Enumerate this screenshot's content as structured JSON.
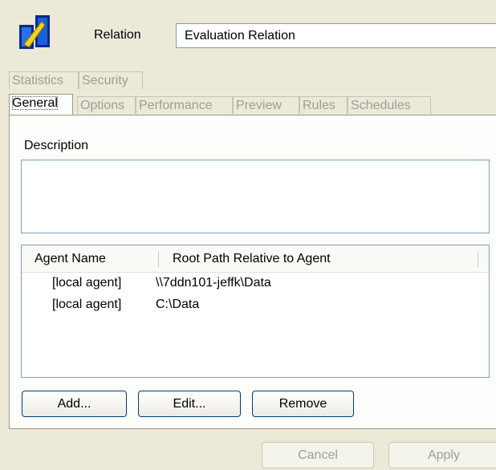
{
  "header": {
    "icon": "relation-icon",
    "relation_label": "Relation",
    "relation_name": "Evaluation Relation"
  },
  "tabs": {
    "row1": [
      {
        "label": "Statistics",
        "active": false
      },
      {
        "label": "Security",
        "active": false
      }
    ],
    "row2": [
      {
        "label": "General",
        "active": true
      },
      {
        "label": "Options",
        "active": false
      },
      {
        "label": "Performance",
        "active": false
      },
      {
        "label": "Preview",
        "active": false
      },
      {
        "label": "Rules",
        "active": false
      },
      {
        "label": "Schedules",
        "active": false
      }
    ]
  },
  "general": {
    "description_label": "Description",
    "description_value": "",
    "agents_table": {
      "columns": [
        "Agent Name",
        "Root Path Relative to Agent"
      ],
      "rows": [
        [
          "[local agent]",
          "\\\\7ddn101-jeffk\\Data"
        ],
        [
          "[local agent]",
          "C:\\Data"
        ]
      ]
    },
    "buttons": {
      "add": "Add...",
      "edit": "Edit...",
      "remove": "Remove"
    }
  },
  "footer": {
    "cancel": "Cancel",
    "apply": "Apply",
    "cancel_enabled": false,
    "apply_enabled": false
  },
  "colors": {
    "dialog_bg": "#ece9d8",
    "panel_bg": "#fdfdfb",
    "field_border": "#7f9db9",
    "button_border": "#003c74",
    "disabled_text": "#9d9c98"
  }
}
